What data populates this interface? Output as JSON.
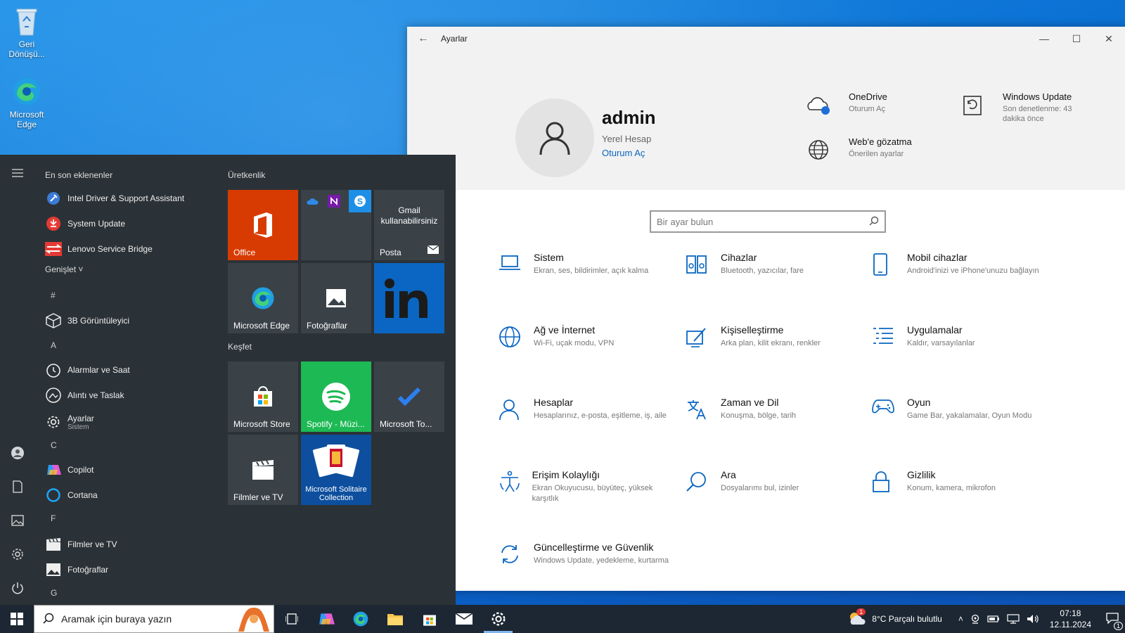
{
  "desktop": {
    "icons": [
      {
        "label": "Geri Dönüşü..."
      },
      {
        "label": "Microsoft Edge"
      }
    ]
  },
  "settings": {
    "window_title": "Ayarlar",
    "user": {
      "name": "admin",
      "type": "Yerel Hesap",
      "link": "Oturum Aç"
    },
    "quick": [
      {
        "title": "OneDrive",
        "sub": "Oturum Aç"
      },
      {
        "title": "Web'e gözatma",
        "sub": "Önerilen ayarlar"
      },
      {
        "title": "Windows Update",
        "sub": "Son denetlenme: 43 dakika önce"
      }
    ],
    "search_placeholder": "Bir ayar bulun",
    "categories": [
      {
        "title": "Sistem",
        "sub": "Ekran, ses, bildirimler, açık kalma"
      },
      {
        "title": "Cihazlar",
        "sub": "Bluetooth, yazıcılar, fare"
      },
      {
        "title": "Mobil cihazlar",
        "sub": "Android'inizi ve iPhone'unuzu bağlayın"
      },
      {
        "title": "Ağ ve İnternet",
        "sub": "Wi-Fi, uçak modu, VPN"
      },
      {
        "title": "Kişiselleştirme",
        "sub": "Arka plan, kilit ekranı, renkler"
      },
      {
        "title": "Uygulamalar",
        "sub": "Kaldır, varsayılanlar"
      },
      {
        "title": "Hesaplar",
        "sub": "Hesaplarınız, e-posta, eşitleme, iş, aile"
      },
      {
        "title": "Zaman ve Dil",
        "sub": "Konuşma, bölge, tarih"
      },
      {
        "title": "Oyun",
        "sub": "Game Bar, yakalamalar, Oyun Modu"
      },
      {
        "title": "Erişim Kolaylığı",
        "sub": "Ekran Okuyucusu, büyüteç, yüksek karşıtlık"
      },
      {
        "title": "Ara",
        "sub": "Dosyalarımı bul, izinler"
      },
      {
        "title": "Gizlilik",
        "sub": "Konum, kamera, mikrofon"
      },
      {
        "title": "Güncelleştirme ve Güvenlik",
        "sub": "Windows Update, yedekleme, kurtarma"
      }
    ]
  },
  "start": {
    "recent_header": "En son eklenenler",
    "expand_label": "Genişlet",
    "recent": [
      {
        "label": "Intel Driver & Support Assistant"
      },
      {
        "label": "System Update"
      },
      {
        "label": "Lenovo Service Bridge"
      }
    ],
    "letters": [
      "#",
      "A",
      "C",
      "F",
      "G"
    ],
    "apps": [
      {
        "label": "3B Görüntüleyici"
      },
      {
        "label": "Alarmlar ve Saat"
      },
      {
        "label": "Alıntı ve Taslak"
      },
      {
        "label": "Ayarlar",
        "sub": "Sistem"
      },
      {
        "label": "Copilot"
      },
      {
        "label": "Cortana"
      },
      {
        "label": "Filmler ve TV"
      },
      {
        "label": "Fotoğraflar"
      }
    ],
    "groups": [
      "Üretkenlik",
      "Keşfet"
    ],
    "tiles": [
      {
        "label": "Office"
      },
      {
        "label": ""
      },
      {
        "label": "Posta",
        "top": "Gmail kullanabilirsiniz"
      },
      {
        "label": "Microsoft Edge"
      },
      {
        "label": "Fotoğraflar"
      },
      {
        "label": ""
      },
      {
        "label": "Microsoft Store"
      },
      {
        "label": "Spotify - Müzi..."
      },
      {
        "label": "Microsoft To..."
      },
      {
        "label": "Filmler ve TV"
      },
      {
        "label": "Microsoft Solitaire Collection"
      }
    ]
  },
  "taskbar": {
    "search_placeholder": "Aramak için buraya yazın",
    "weather": "8°C  Parçalı bulutlu",
    "weather_badge": "1",
    "time": "07:18",
    "date": "12.11.2024",
    "notif_count": "1"
  },
  "colors": {
    "accent": "#0a66c2",
    "office_tile": "#d83b01",
    "spotify_tile": "#1db954",
    "linkedin_tile": "#0a66c2",
    "start_bg": "#2b3237"
  }
}
